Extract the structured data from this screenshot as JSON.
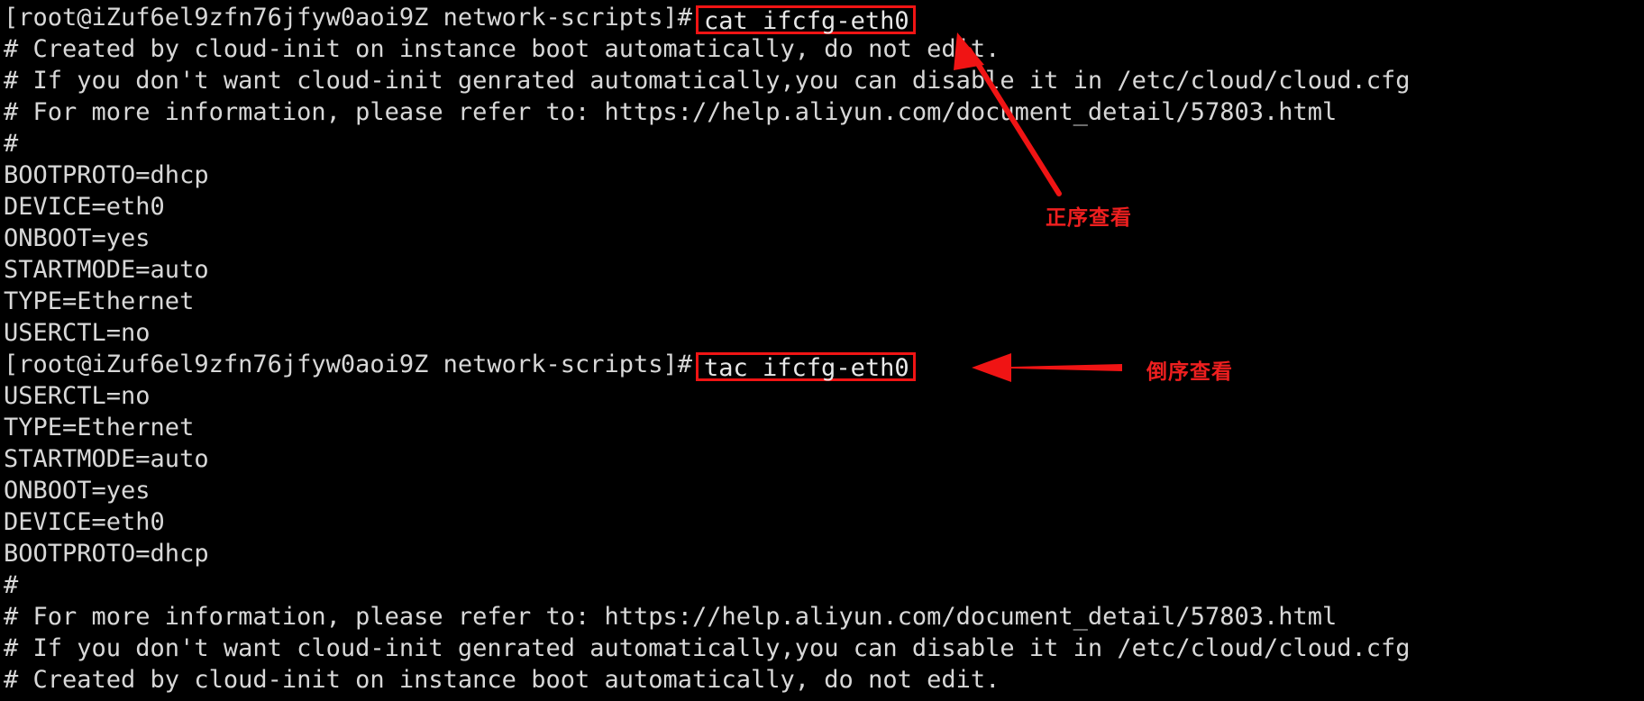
{
  "terminal": {
    "prompt_user": "root",
    "prompt_host": "iZuf6el9zfn76jfyw0aoi9Z",
    "prompt_dir": "network-scripts",
    "prompt_prefix_1": "[root@iZuf6el9zfn76jfyw0aoi9Z network-scripts]#",
    "prompt_prefix_2": "[root@iZuf6el9zfn76jfyw0aoi9Z network-scripts]#",
    "command_1": "cat ifcfg-eth0",
    "command_2": "tac ifcfg-eth0",
    "cat_output": [
      "# Created by cloud-init on instance boot automatically, do not edit.",
      "# If you don't want cloud-init genrated automatically,you can disable it in /etc/cloud/cloud.cfg",
      "# For more information, please refer to: https://help.aliyun.com/document_detail/57803.html",
      "#",
      "BOOTPROTO=dhcp",
      "DEVICE=eth0",
      "ONBOOT=yes",
      "STARTMODE=auto",
      "TYPE=Ethernet",
      "USERCTL=no"
    ],
    "tac_output": [
      "USERCTL=no",
      "TYPE=Ethernet",
      "STARTMODE=auto",
      "ONBOOT=yes",
      "DEVICE=eth0",
      "BOOTPROTO=dhcp",
      "#",
      "# For more information, please refer to: https://help.aliyun.com/document_detail/57803.html",
      "# If you don't want cloud-init genrated automatically,you can disable it in /etc/cloud/cloud.cfg",
      "# Created by cloud-init on instance boot automatically, do not edit."
    ]
  },
  "annotations": {
    "forward_label": "正序查看",
    "reverse_label": "倒序查看"
  },
  "colors": {
    "background": "#000000",
    "text": "#d8d8d8",
    "annotation_red": "#ef1f1f",
    "box_red": "#f01414"
  }
}
